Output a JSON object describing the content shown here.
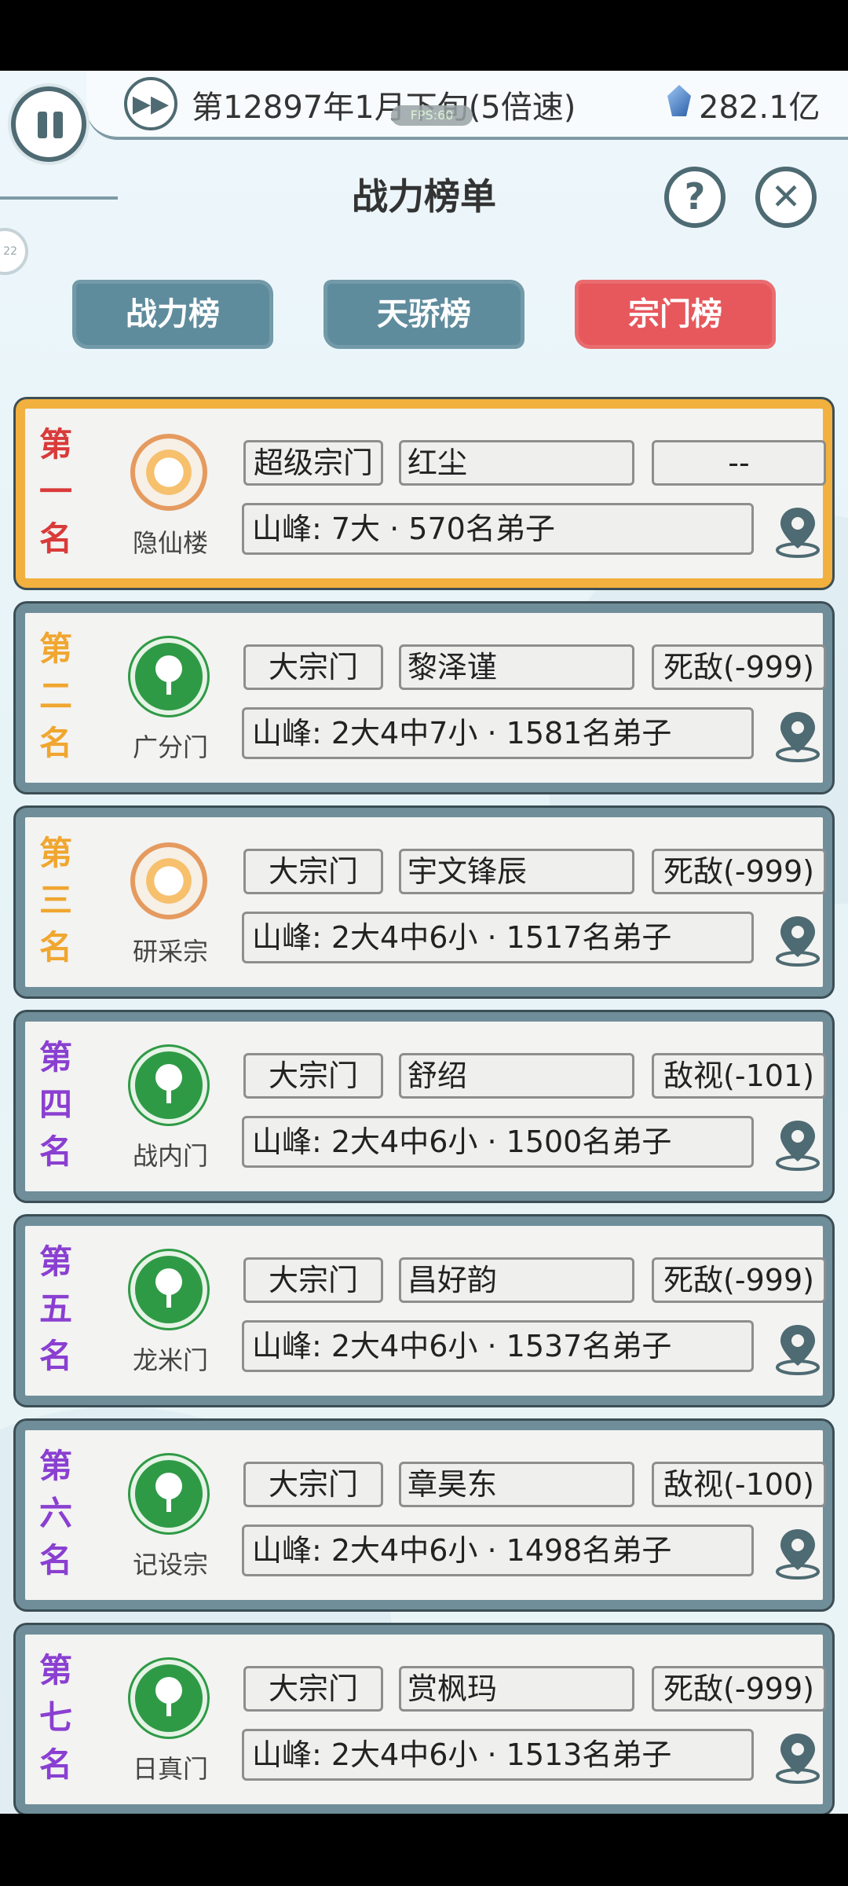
{
  "status": {
    "date": "第12897年1月下旬(5倍速)",
    "fps": "FPS:60",
    "currency": "282.1亿",
    "side_badge": "22"
  },
  "panel": {
    "title": "战力榜单",
    "help": "?",
    "close": "✕"
  },
  "tabs": [
    {
      "label": "战力榜",
      "active": false
    },
    {
      "label": "天骄榜",
      "active": false
    },
    {
      "label": "宗门榜",
      "active": true
    }
  ],
  "rankings": [
    {
      "rank_chars": [
        "第",
        "一",
        "名"
      ],
      "rank_color": "#d93a3a",
      "emblem": "sun",
      "sect": "隐仙楼",
      "type": "超级宗门",
      "leader": "红尘",
      "relation": "--",
      "peaks": "山峰: 7大 · 570名弟子"
    },
    {
      "rank_chars": [
        "第",
        "二",
        "名"
      ],
      "rank_color": "#f0a630",
      "emblem": "tree",
      "sect": "广分门",
      "type": "大宗门",
      "leader": "黎泽谨",
      "relation": "死敌(-999)",
      "peaks": "山峰: 2大4中7小 · 1581名弟子"
    },
    {
      "rank_chars": [
        "第",
        "三",
        "名"
      ],
      "rank_color": "#f0a630",
      "emblem": "sun",
      "sect": "研采宗",
      "type": "大宗门",
      "leader": "宇文锋辰",
      "relation": "死敌(-999)",
      "peaks": "山峰: 2大4中6小 · 1517名弟子"
    },
    {
      "rank_chars": [
        "第",
        "四",
        "名"
      ],
      "rank_color": "#8a3fd1",
      "emblem": "tree",
      "sect": "战内门",
      "type": "大宗门",
      "leader": "舒绍",
      "relation": "敌视(-101)",
      "peaks": "山峰: 2大4中6小 · 1500名弟子"
    },
    {
      "rank_chars": [
        "第",
        "五",
        "名"
      ],
      "rank_color": "#8a3fd1",
      "emblem": "tree",
      "sect": "龙米门",
      "type": "大宗门",
      "leader": "昌好韵",
      "relation": "死敌(-999)",
      "peaks": "山峰: 2大4中6小 · 1537名弟子"
    },
    {
      "rank_chars": [
        "第",
        "六",
        "名"
      ],
      "rank_color": "#8a3fd1",
      "emblem": "tree",
      "sect": "记设宗",
      "type": "大宗门",
      "leader": "章昊东",
      "relation": "敌视(-100)",
      "peaks": "山峰: 2大4中6小 · 1498名弟子"
    },
    {
      "rank_chars": [
        "第",
        "七",
        "名"
      ],
      "rank_color": "#8a3fd1",
      "emblem": "tree",
      "sect": "日真门",
      "type": "大宗门",
      "leader": "赏枫玛",
      "relation": "死敌(-999)",
      "peaks": "山峰: 2大4中6小 · 1513名弟子"
    }
  ],
  "icons": {
    "pause": "pause-icon",
    "fast_forward": "fast-forward-icon",
    "currency": "spirit-stone-icon",
    "location": "map-pin-icon"
  }
}
